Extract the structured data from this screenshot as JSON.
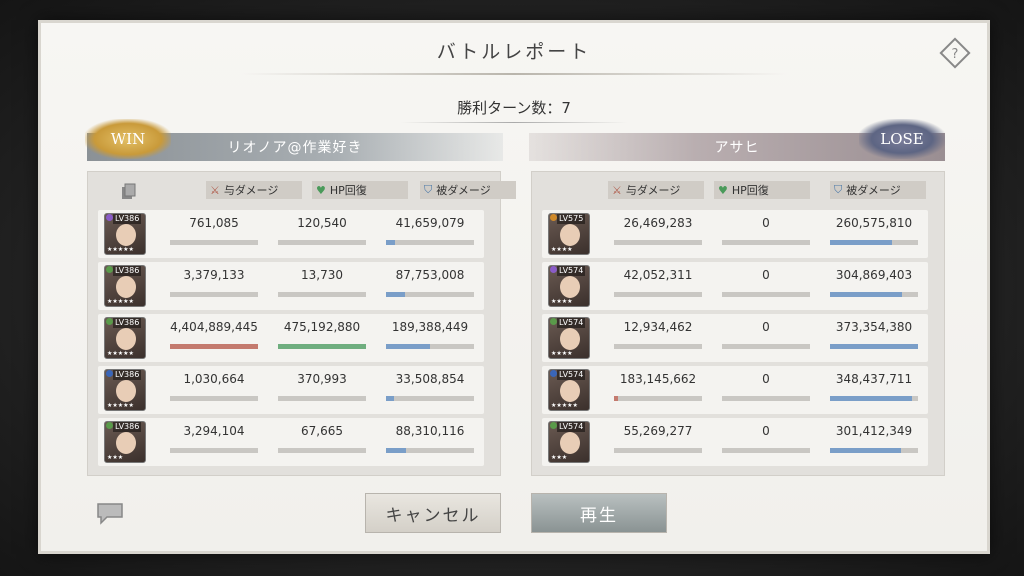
{
  "title": "バトルレポート",
  "turns_text": "勝利ターン数：7",
  "left": {
    "result": "WIN",
    "player": "リオノア@作業好き",
    "headers": [
      "与ダメージ",
      "HP回復",
      "被ダメージ"
    ],
    "rows": [
      {
        "lv": "LV386",
        "stars": "★★★★★",
        "rarity": "#8a5cc8",
        "dmg": "761,085",
        "heal": "120,540",
        "taken": "41,659,079",
        "dmg_pct": 0.0,
        "heal_pct": 0.0,
        "taken_pct": 0.1
      },
      {
        "lv": "LV386",
        "stars": "★★★★★",
        "rarity": "#5a9a4a",
        "dmg": "3,379,133",
        "heal": "13,730",
        "taken": "87,753,008",
        "dmg_pct": 0.0,
        "heal_pct": 0.0,
        "taken_pct": 0.22
      },
      {
        "lv": "LV386",
        "stars": "★★★★★",
        "rarity": "#5a9a4a",
        "dmg": "4,404,889,445",
        "heal": "475,192,880",
        "taken": "189,388,449",
        "dmg_pct": 1.0,
        "heal_pct": 1.0,
        "taken_pct": 0.5
      },
      {
        "lv": "LV386",
        "stars": "★★★★★",
        "rarity": "#3a66b8",
        "dmg": "1,030,664",
        "heal": "370,993",
        "taken": "33,508,854",
        "dmg_pct": 0.0,
        "heal_pct": 0.0,
        "taken_pct": 0.09
      },
      {
        "lv": "LV386",
        "stars": "★★★",
        "rarity": "#5a9a4a",
        "dmg": "3,294,104",
        "heal": "67,665",
        "taken": "88,310,116",
        "dmg_pct": 0.0,
        "heal_pct": 0.0,
        "taken_pct": 0.23
      }
    ]
  },
  "right": {
    "result": "LOSE",
    "player": "アサヒ",
    "headers": [
      "与ダメージ",
      "HP回復",
      "被ダメージ"
    ],
    "rows": [
      {
        "lv": "LV575",
        "stars": "★★★★",
        "rarity": "#d08a2a",
        "dmg": "26,469,283",
        "heal": "0",
        "taken": "260,575,810",
        "dmg_pct": 0.0,
        "heal_pct": 0.0,
        "taken_pct": 0.7
      },
      {
        "lv": "LV574",
        "stars": "★★★★",
        "rarity": "#8a5cc8",
        "dmg": "42,052,311",
        "heal": "0",
        "taken": "304,869,403",
        "dmg_pct": 0.0,
        "heal_pct": 0.0,
        "taken_pct": 0.82
      },
      {
        "lv": "LV574",
        "stars": "★★★★",
        "rarity": "#5a9a4a",
        "dmg": "12,934,462",
        "heal": "0",
        "taken": "373,354,380",
        "dmg_pct": 0.0,
        "heal_pct": 0.0,
        "taken_pct": 1.0
      },
      {
        "lv": "LV574",
        "stars": "★★★★★",
        "rarity": "#3a66b8",
        "dmg": "183,145,662",
        "heal": "0",
        "taken": "348,437,711",
        "dmg_pct": 0.04,
        "heal_pct": 0.0,
        "taken_pct": 0.93
      },
      {
        "lv": "LV574",
        "stars": "★★★",
        "rarity": "#5a9a4a",
        "dmg": "55,269,277",
        "heal": "0",
        "taken": "301,412,349",
        "dmg_pct": 0.0,
        "heal_pct": 0.0,
        "taken_pct": 0.81
      }
    ]
  },
  "buttons": {
    "cancel": "キャンセル",
    "play": "再生"
  },
  "colors": {
    "damage": "#c47a6e",
    "heal": "#6fae7f",
    "taken": "#7a9ec8"
  },
  "icons": {
    "help": "help-icon",
    "copy": "copy-icon",
    "chat": "chat-bubble-icon",
    "sword": "sword-icon",
    "heart": "heart-icon",
    "shield": "shield-icon"
  }
}
